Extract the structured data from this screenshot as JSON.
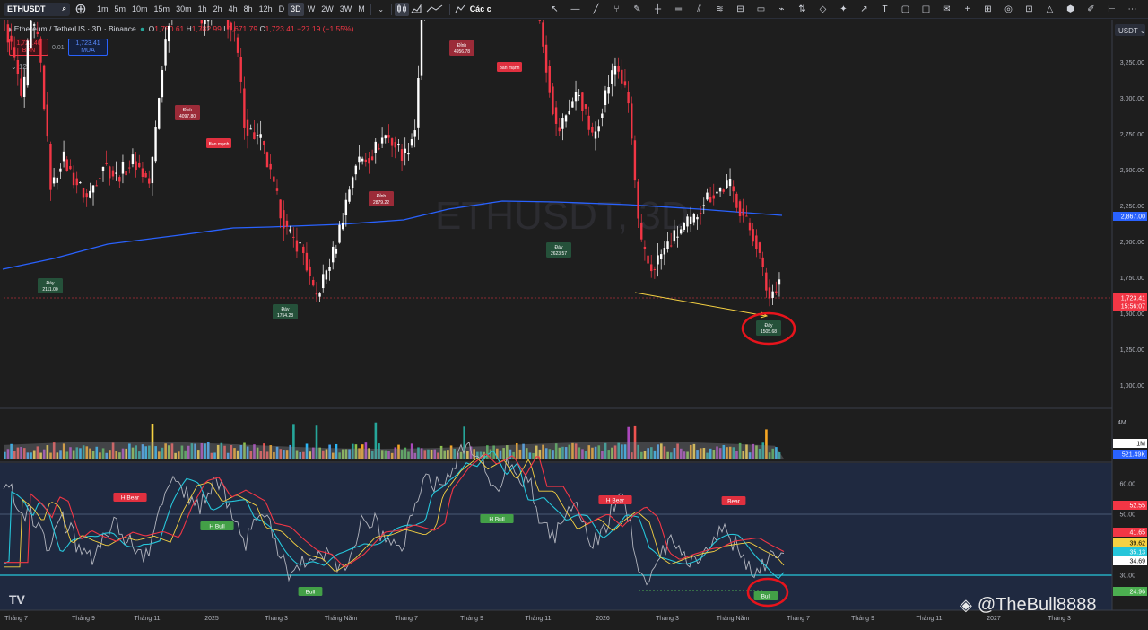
{
  "toolbar": {
    "symbol": "ETHUSDT",
    "intervals": [
      "1m",
      "5m",
      "10m",
      "15m",
      "30m",
      "1h",
      "2h",
      "4h",
      "8h",
      "12h",
      "D",
      "3D",
      "W",
      "2W",
      "3W",
      "M"
    ],
    "active_interval": "3D",
    "indicators_label": "Các c"
  },
  "legend": {
    "title": "Ethereum / TetherUS · 3D · Binance",
    "o_label": "O",
    "o": "1,750.61",
    "h_label": "H",
    "h": "1,782.99",
    "l_label": "L",
    "l": "1,671.79",
    "c_label": "C",
    "c": "1,723.41",
    "change": "−27.19 (−1.55%)",
    "sell_price": "1,723.40",
    "sell_label": "BÁN",
    "spread": "0.01",
    "buy_price": "1,723.41",
    "buy_label": "MUA",
    "collapsed_count": "12"
  },
  "watermark_symbol": "ETHUSDT, 3D",
  "price_axis": {
    "currency": "USDT",
    "ticks": [
      "5,250.00",
      "5,000.00",
      "4,750.00",
      "4,500.00",
      "4,250.00",
      "4,000.00",
      "3,750.00",
      "3,500.00",
      "3,250.00",
      "3,000.00",
      "2,750.00",
      "2,500.00",
      "2,250.00",
      "2,000.00",
      "1,750.00",
      "1,500.00",
      "1,250.00",
      "1,000.00",
      "750.00",
      "500.00",
      "250.00"
    ],
    "ma_label": "2,867.00",
    "last_price": "1,723.41",
    "countdown": "15:56:07"
  },
  "volume_axis": {
    "ticks": [
      "4M",
      "1M"
    ],
    "current": "521.49K"
  },
  "osc_axis": {
    "ticks": [
      "60.00",
      "50.00",
      "40.00",
      "30.00"
    ],
    "labels": [
      {
        "text": "52.55",
        "color": "#f23645"
      },
      {
        "text": "41.65",
        "color": "#f23645"
      },
      {
        "text": "39.62",
        "color": "#f5d142"
      },
      {
        "text": "35.13",
        "color": "#26c6da"
      },
      {
        "text": "34.69",
        "color": "#ffffff"
      },
      {
        "text": "24.96",
        "color": "#4caf50"
      }
    ]
  },
  "time_axis": [
    "Tháng 7",
    "Tháng 9",
    "Tháng 11",
    "2025",
    "Tháng 3",
    "Tháng Năm",
    "Tháng 7",
    "Tháng 9",
    "Tháng 11",
    "2026",
    "Tháng 3",
    "Tháng Năm",
    "Tháng 7",
    "Tháng 9",
    "Tháng 11",
    "2027",
    "Tháng 3"
  ],
  "annotations": {
    "peaks": [
      {
        "label": "Đỉnh",
        "value": "4097.80"
      },
      {
        "label": "Đỉnh",
        "value": "2879.22"
      },
      {
        "label": "Đỉnh",
        "value": "4956.78"
      }
    ],
    "strong_sell": "Bán mạnh",
    "troughs": [
      {
        "label": "Đáy",
        "value": "2111.00"
      },
      {
        "label": "Đáy",
        "value": "1754.28"
      },
      {
        "label": "Đáy",
        "value": "2623.57"
      },
      {
        "label": "Đáy",
        "value": "1505.68"
      }
    ],
    "osc_tags": [
      "H Bear",
      "H Bull",
      "Bull",
      "H Bull",
      "H Bear",
      "Bear",
      "Bull"
    ]
  },
  "colors": {
    "up": "#ffffff",
    "down": "#f23645",
    "ma": "#2962ff",
    "osc_bg": "#1f2940",
    "trend": "#f5d142",
    "circle": "#e8141c"
  },
  "credit": "@TheBull8888"
}
